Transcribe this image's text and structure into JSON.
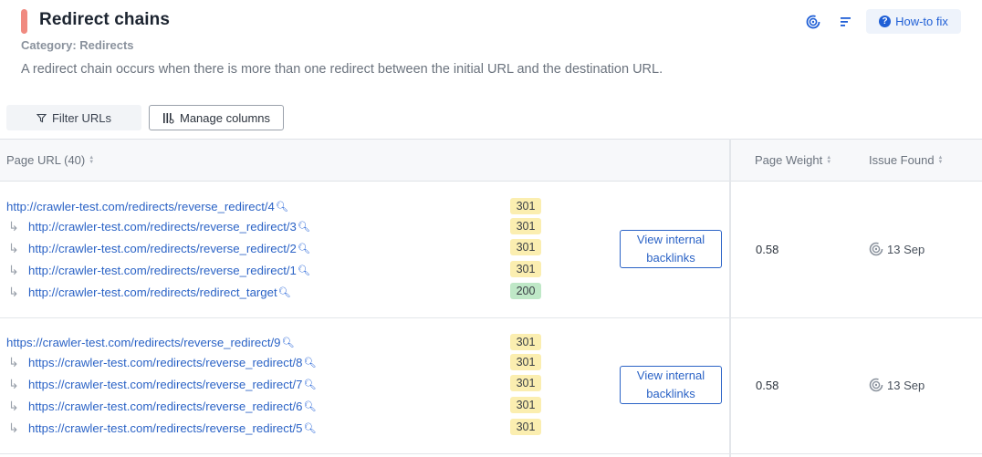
{
  "header": {
    "title": "Redirect chains",
    "category": "Category: Redirects",
    "description": "A redirect chain occurs when there is more than one redirect between the initial URL and the destination URL.",
    "howto_label": "How-to fix"
  },
  "toolbar": {
    "filter_label": "Filter URLs",
    "manage_label": "Manage columns"
  },
  "table": {
    "columns": {
      "page_url": "Page URL (40)",
      "page_weight": "Page Weight",
      "issue_found": "Issue Found"
    },
    "groups": [
      {
        "urls": [
          {
            "url": "http://crawler-test.com/redirects/reverse_redirect/4",
            "status": "301"
          },
          {
            "url": "http://crawler-test.com/redirects/reverse_redirect/3",
            "status": "301"
          },
          {
            "url": "http://crawler-test.com/redirects/reverse_redirect/2",
            "status": "301"
          },
          {
            "url": "http://crawler-test.com/redirects/reverse_redirect/1",
            "status": "301"
          },
          {
            "url": "http://crawler-test.com/redirects/redirect_target",
            "status": "200"
          }
        ],
        "backlinks_label": "View internal backlinks",
        "page_weight": "0.58",
        "issue_found": "13 Sep"
      },
      {
        "urls": [
          {
            "url": "https://crawler-test.com/redirects/reverse_redirect/9",
            "status": "301"
          },
          {
            "url": "https://crawler-test.com/redirects/reverse_redirect/8",
            "status": "301"
          },
          {
            "url": "https://crawler-test.com/redirects/reverse_redirect/7",
            "status": "301"
          },
          {
            "url": "https://crawler-test.com/redirects/reverse_redirect/6",
            "status": "301"
          },
          {
            "url": "https://crawler-test.com/redirects/reverse_redirect/5",
            "status": "301"
          }
        ],
        "backlinks_label": "View internal backlinks",
        "page_weight": "0.58",
        "issue_found": "13 Sep"
      }
    ]
  },
  "icons": {
    "header_actions": [
      "history-icon",
      "sort-icon"
    ],
    "howto": "question-icon",
    "filter": "filter-icon",
    "manage": "columns-icon",
    "url": "magnifier-icon",
    "issue": "history-icon"
  },
  "colors": {
    "accent": "#f08a80",
    "link": "#2b63c6",
    "badge_301": "#fbeeb0",
    "badge_200": "#bfe8c7"
  }
}
